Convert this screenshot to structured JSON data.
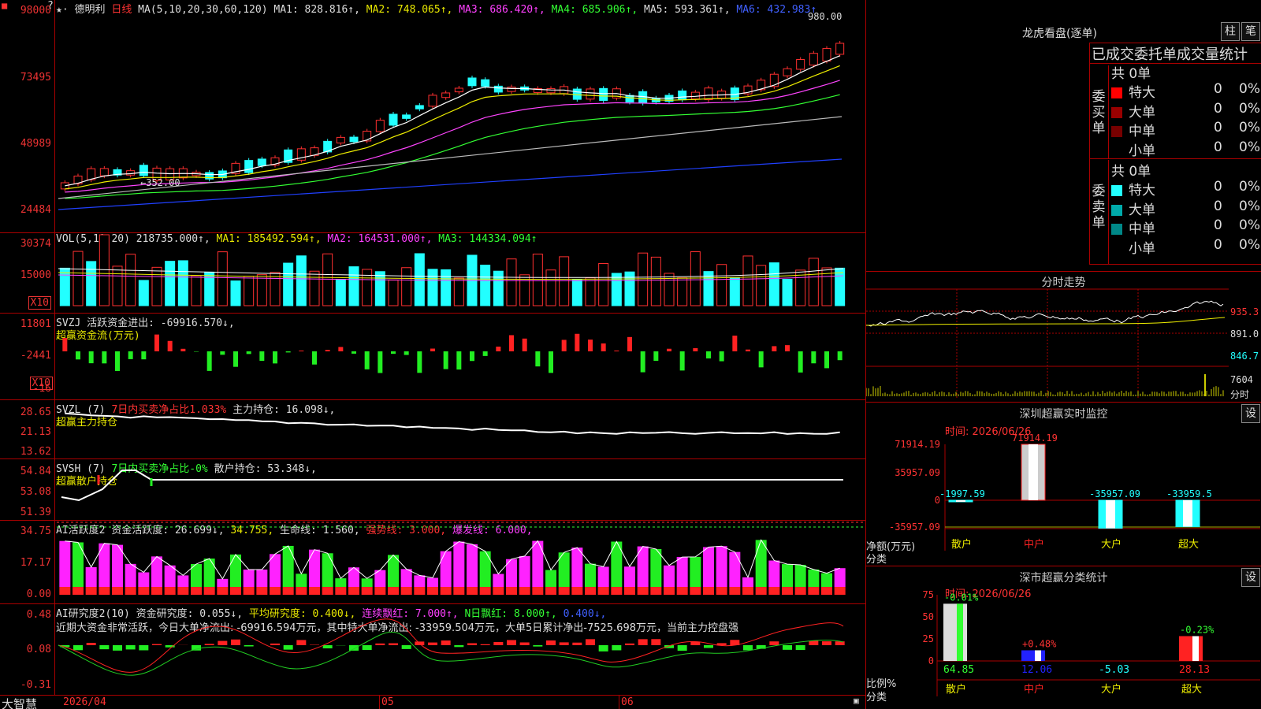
{
  "header": {
    "star": "★·",
    "stock_name": "德明利",
    "period": "日线",
    "ma_params": "MA(5,10,20,30,60,120)",
    "ma1": "MA1: 828.816↑,",
    "ma2": "MA2: 748.065↑,",
    "ma3": "MA3: 686.420↑,",
    "ma4": "MA4: 685.906↑,",
    "ma5": "MA5: 593.361↑,",
    "ma6": "MA6: 432.983↑",
    "q": "?"
  },
  "price_pane": {
    "y_labels": [
      "98000",
      "73495",
      "48989",
      "24484"
    ],
    "high_label": "980.00",
    "low_label": "352.00"
  },
  "vol_pane": {
    "title": "VOL(5,10,20)",
    "value": "218735.000↑,",
    "ma1": "MA1: 185492.594↑,",
    "ma2": "MA2: 164531.000↑,",
    "ma3": "MA3: 144334.094↑",
    "y_labels": [
      "30374",
      "15000"
    ],
    "unit": "X10"
  },
  "svzj_pane": {
    "title": "SVZJ",
    "label": "活跃资金进出: -69916.570↓,",
    "sub": "超赢资金流(万元)",
    "y_labels": [
      "11801",
      "-2441",
      "-16"
    ],
    "unit": "X10"
  },
  "svzl_pane": {
    "title": "SVZL (7)",
    "label": "7日内买卖净占比1.033%",
    "holding": "主力持仓: 16.098↓,",
    "sub": "超赢主力持仓",
    "y_labels": [
      "28.65",
      "21.13",
      "13.62"
    ]
  },
  "svsh_pane": {
    "title": "SVSH (7)",
    "label": "7日内买卖净占比-0%",
    "holding": "散户持仓: 53.348↓,",
    "sub": "超赢散户持仓",
    "y_labels": [
      "54.84",
      "53.08",
      "51.39"
    ]
  },
  "ai_active": {
    "title": "AI活跃度2",
    "label": "资金活跃度: 26.699↓,",
    "v2": "34.755,",
    "life": "生命线: 1.560,",
    "strong": "强势线: 3.000,",
    "burst": "爆发线: 6.000,",
    "y_labels": [
      "34.75",
      "17.17",
      "0.00"
    ]
  },
  "ai_research": {
    "title": "AI研究度2(10)",
    "label": "资金研究度: 0.055↓,",
    "avg": "平均研究度: 0.400↓,",
    "cont": "连续飘红: 7.000↑,",
    "nday": "N日飘红: 8.000↑,",
    "last": "0.400↓,",
    "comment": "近期大资金非常活跃，今日大单净流出: -69916.594万元，其中特大单净流出: -33959.504万元，大单5日累计净出-7525.698万元，当前主力控盘强",
    "y_labels": [
      "0.48",
      "0.08",
      "-0.31"
    ]
  },
  "bottom": {
    "brand": "大智慧",
    "dates": [
      "2026/04",
      "05",
      "06"
    ]
  },
  "dragon": {
    "title": "龙虎看盘(逐单)",
    "btn1": "柱",
    "btn2": "笔",
    "tabs": "已成交委托单成交量统计",
    "buy": {
      "side": "委买单",
      "total": "共 0单",
      "rows": [
        {
          "name": "特大",
          "val": "0",
          "pct": "0%",
          "color": "#f00"
        },
        {
          "name": "大单",
          "val": "0",
          "pct": "0%",
          "color": "#900"
        },
        {
          "name": "中单",
          "val": "0",
          "pct": "0%",
          "color": "#700"
        },
        {
          "name": "小单",
          "val": "0",
          "pct": "0%",
          "color": "#000"
        }
      ]
    },
    "sell": {
      "side": "委卖单",
      "total": "共 0单",
      "rows": [
        {
          "name": "特大",
          "val": "0",
          "pct": "0%",
          "color": "#2ff"
        },
        {
          "name": "大单",
          "val": "0",
          "pct": "0%",
          "color": "#0aa"
        },
        {
          "name": "中单",
          "val": "0",
          "pct": "0%",
          "color": "#088"
        },
        {
          "name": "小单",
          "val": "0",
          "pct": "0%",
          "color": "#000"
        }
      ]
    }
  },
  "intraday": {
    "title": "分时走势",
    "y_labels": [
      "935.3",
      "891.0",
      "846.7"
    ],
    "vol_label": "7604",
    "sub": "分时"
  },
  "monitor": {
    "title": "深圳超赢实时监控",
    "btn": "设",
    "time": "时间: 2026/06/26",
    "y_labels": [
      "71914.19",
      "35957.09",
      "0",
      "-35957.09"
    ],
    "y_title": "净额(万元)",
    "y_sub": "分类",
    "cats": [
      "散户",
      "中户",
      "大户",
      "超大"
    ],
    "vals": [
      "-1997.59",
      "71914.19",
      "-35957.09",
      "-33959.5"
    ],
    "values": [
      -1997.59,
      71914.19,
      -35957.09,
      -33959.5
    ]
  },
  "classify": {
    "title": "深市超赢分类统计",
    "btn": "设",
    "time": "时间: 2026/06/26",
    "y_labels": [
      "75",
      "50",
      "25",
      "0"
    ],
    "y_title": "比例%",
    "y_sub": "分类",
    "cats": [
      "散户",
      "中户",
      "大户",
      "超大"
    ],
    "top": [
      "-0.01%",
      "+0.48%",
      "",
      "-0.23%"
    ],
    "bottom": [
      "64.85",
      "12.06",
      "-5.03",
      "28.13"
    ],
    "values": [
      64.85,
      12.06,
      -5.03,
      28.13
    ]
  }
}
